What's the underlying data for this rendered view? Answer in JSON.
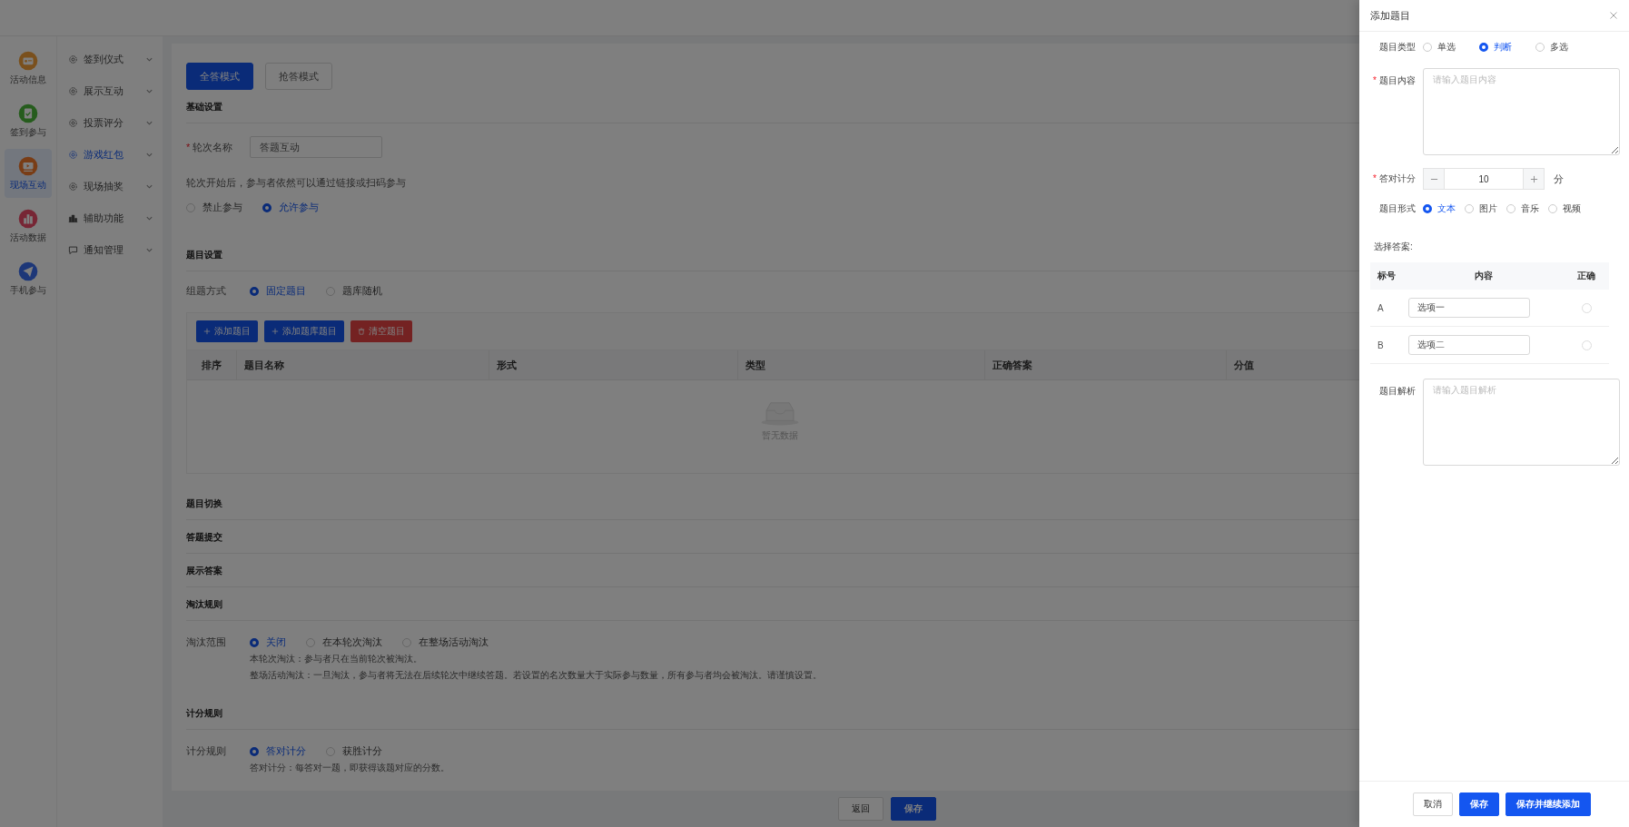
{
  "rail": [
    {
      "label": "活动信息",
      "selected": false
    },
    {
      "label": "签到参与",
      "selected": false
    },
    {
      "label": "现场互动",
      "selected": true
    },
    {
      "label": "活动数据",
      "selected": false
    },
    {
      "label": "手机参与",
      "selected": false
    }
  ],
  "menu": [
    {
      "label": "签到仪式",
      "selected": false
    },
    {
      "label": "展示互动",
      "selected": false
    },
    {
      "label": "投票评分",
      "selected": false
    },
    {
      "label": "游戏红包",
      "selected": true
    },
    {
      "label": "现场抽奖",
      "selected": false
    },
    {
      "label": "辅助功能",
      "selected": false
    },
    {
      "label": "通知管理",
      "selected": false
    }
  ],
  "modes": [
    {
      "label": "全答模式",
      "selected": true
    },
    {
      "label": "抢答模式",
      "selected": false
    }
  ],
  "basic": {
    "title": "基础设置",
    "name_mark": "*",
    "name_label": "轮次名称",
    "name_value": "答题互动",
    "join_hint": "轮次开始后，参与者依然可以通过链接或扫码参与",
    "join_options": [
      {
        "label": "禁止参与",
        "selected": false
      },
      {
        "label": "允许参与",
        "selected": true
      }
    ]
  },
  "question_settings": {
    "title": "题目设置",
    "method_label": "组题方式",
    "methods": [
      {
        "label": "固定题目",
        "selected": true
      },
      {
        "label": "题库随机",
        "selected": false
      }
    ],
    "toolbar": [
      {
        "label": "添加题目",
        "kind": "add"
      },
      {
        "label": "添加题库题目",
        "kind": "add"
      },
      {
        "label": "清空题目",
        "kind": "clear"
      }
    ],
    "columns": [
      "排序",
      "题目名称",
      "形式",
      "类型",
      "正确答案",
      "分值"
    ],
    "empty_text": "暂无数据"
  },
  "collapsed_sections": [
    "题目切换",
    "答题提交",
    "展示答案"
  ],
  "elimination": {
    "title": "淘汰规则",
    "range_label": "淘汰范围",
    "options": [
      {
        "label": "关闭",
        "selected": true
      },
      {
        "label": "在本轮次淘汰",
        "selected": false
      },
      {
        "label": "在整场活动淘汰",
        "selected": false
      }
    ],
    "notes": [
      "本轮次淘汰：参与者只在当前轮次被淘汰。",
      "整场活动淘汰：一旦淘汰，参与者将无法在后续轮次中继续答题。若设置的名次数量大于实际参与数量，所有参与者均会被淘汰。请谨慎设置。"
    ]
  },
  "scoring": {
    "title": "计分规则",
    "rule_label": "计分规则",
    "options": [
      {
        "label": "答对计分",
        "selected": true
      },
      {
        "label": "获胜计分",
        "selected": false
      }
    ],
    "note": "答对计分：每答对一题，即获得该题对应的分数。"
  },
  "footer_buttons": [
    {
      "label": "返回",
      "kind": "default"
    },
    {
      "label": "保存",
      "kind": "primary"
    }
  ],
  "drawer": {
    "title": "添加题目",
    "type_label": "题目类型",
    "types": [
      {
        "label": "单选",
        "selected": false
      },
      {
        "label": "判断",
        "selected": true
      },
      {
        "label": "多选",
        "selected": false
      }
    ],
    "content_mark": "*",
    "content_label": "题目内容",
    "content_placeholder": "请输入题目内容",
    "score_mark": "*",
    "score_label": "答对计分",
    "score_value": "10",
    "score_unit": "分",
    "form_label": "题目形式",
    "forms": [
      {
        "label": "文本",
        "selected": true
      },
      {
        "label": "图片",
        "selected": false
      },
      {
        "label": "音乐",
        "selected": false
      },
      {
        "label": "视频",
        "selected": false
      }
    ],
    "answers_label": "选择答案:",
    "answer_columns": [
      "标号",
      "内容",
      "正确"
    ],
    "answers": [
      {
        "tag": "A",
        "value": "选项一",
        "correct": false
      },
      {
        "tag": "B",
        "value": "选项二",
        "correct": false
      }
    ],
    "analysis_label": "题目解析",
    "analysis_placeholder": "请输入题目解析",
    "buttons": [
      {
        "label": "取消",
        "kind": "default"
      },
      {
        "label": "保存",
        "kind": "primary"
      },
      {
        "label": "保存并继续添加",
        "kind": "primary"
      }
    ]
  }
}
